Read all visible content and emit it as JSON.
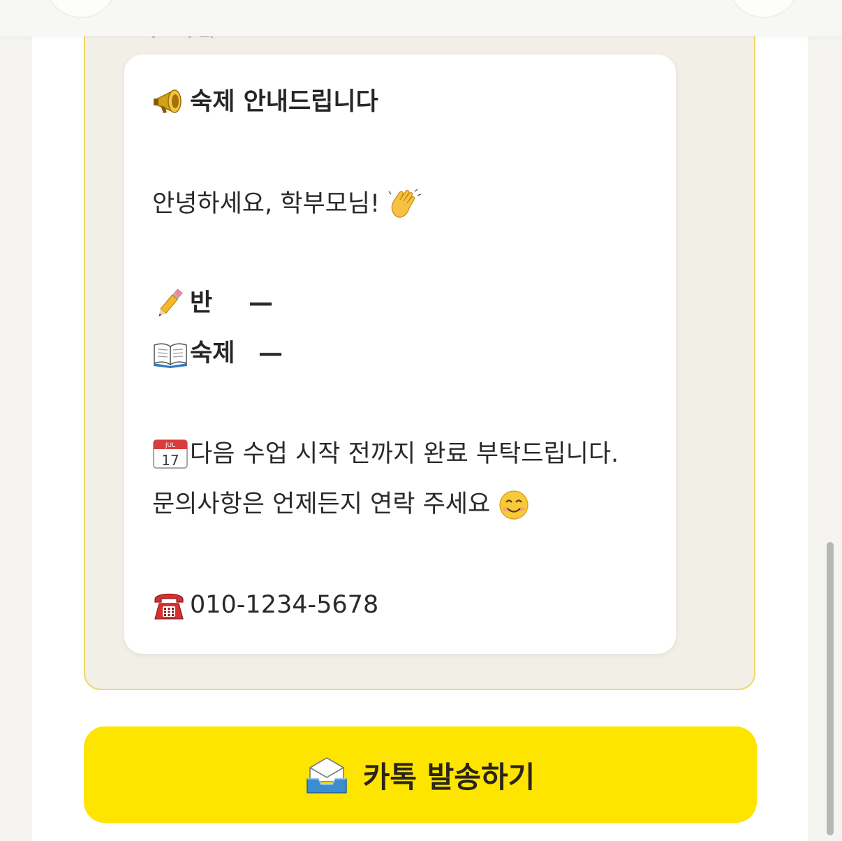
{
  "preview": {
    "title": "숙제 안내드립니다",
    "greeting": "안녕하세요, 학부모님!",
    "class_label": "반",
    "class_value": "—",
    "homework_label": "숙제",
    "homework_value": "—",
    "deadline_line": "다음 수업 시작 전까지 완료 부탁드립니다.",
    "contact_line": "문의사항은 언제든지 연락 주세요",
    "phone": "010-1234-5678"
  },
  "icons": {
    "title": "megaphone-icon",
    "greeting": "waving-hand-icon",
    "class": "pencil-icon",
    "homework": "open-book-icon",
    "deadline": "calendar-icon",
    "contact": "smiling-face-icon",
    "phone": "telephone-icon",
    "send": "envelope-tray-icon"
  },
  "calendar_icon": {
    "month": "JUL",
    "day": "17"
  },
  "send_button": {
    "label": "카톡 발송하기"
  },
  "colors": {
    "accent_yellow": "#fee500",
    "frame_border": "#eed96a",
    "frame_background": "#f2efe7"
  }
}
